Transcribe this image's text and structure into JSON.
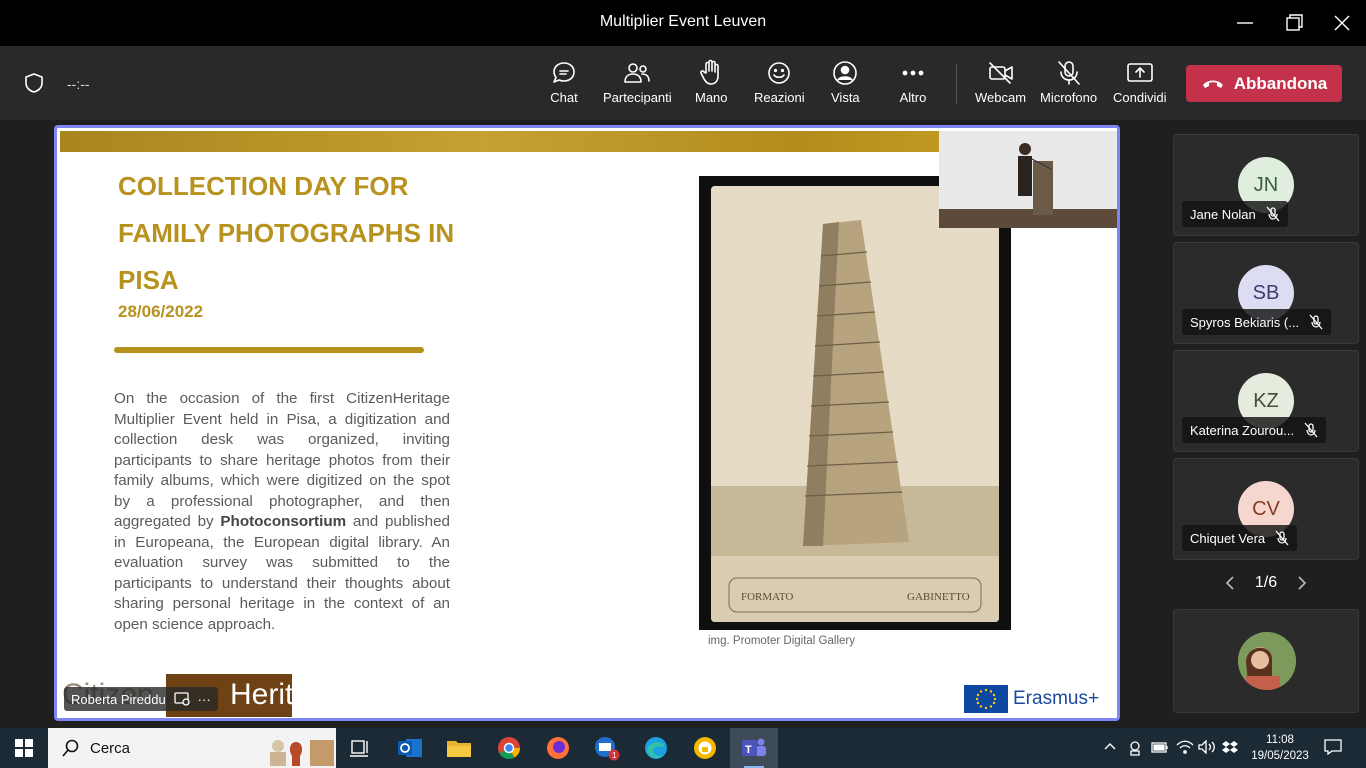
{
  "window": {
    "title": "Multiplier Event Leuven"
  },
  "toolbar": {
    "timer": "--:--",
    "buttons": [
      {
        "label": "Chat"
      },
      {
        "label": "Partecipanti"
      },
      {
        "label": "Mano"
      },
      {
        "label": "Reazioni"
      },
      {
        "label": "Vista"
      },
      {
        "label": "Altro"
      },
      {
        "label": "Webcam"
      },
      {
        "label": "Microfono"
      },
      {
        "label": "Condividi"
      }
    ],
    "leave_label": "Abbandona",
    "leave_color": "#c4314b"
  },
  "slide": {
    "title": "COLLECTION DAY FOR FAMILY PHOTOGRAPHS IN PISA",
    "date": "28/06/2022",
    "body_pre": "On the occasion of the first CitizenHeritage Multiplier Event held in Pisa, a digitization and collection desk was organized, inviting participants to share heritage photos from their family albums, which were digitized on the spot by a professional photographer, and then aggregated by ",
    "body_bold": "Photoconsortium",
    "body_post": " and published in Europeana, the European digital library. An evaluation survey was submitted to the participants to understand their thoughts about sharing personal heritage in the context of an open science approach.",
    "caption": "img. Promoter Digital Gallery",
    "photo_text_left": "FORMATO",
    "photo_text_right": "GABINETTO",
    "logo_left_a": "Citizen",
    "logo_left_b": "Heritage",
    "logo_right": "Erasmus+",
    "accent": "#b8921e"
  },
  "presenter": {
    "name": "Roberta Pireddu"
  },
  "participants": [
    {
      "initials": "JN",
      "name": "Jane Nolan",
      "bg": "#dfeedd",
      "fg": "#3b5e3b"
    },
    {
      "initials": "SB",
      "name": "Spyros Bekiaris (...",
      "bg": "#dcdcf3",
      "fg": "#3d3d6e"
    },
    {
      "initials": "KZ",
      "name": "Katerina Zourou...",
      "bg": "#e5ecde",
      "fg": "#3f4f30"
    },
    {
      "initials": "CV",
      "name": "Chiquet Vera",
      "bg": "#f6d7d0",
      "fg": "#8a3a28"
    }
  ],
  "pager": {
    "text": "1/6"
  },
  "taskbar": {
    "search_label": "Cerca",
    "mail_badge": "1",
    "time": "11:08",
    "date": "19/05/2023"
  }
}
